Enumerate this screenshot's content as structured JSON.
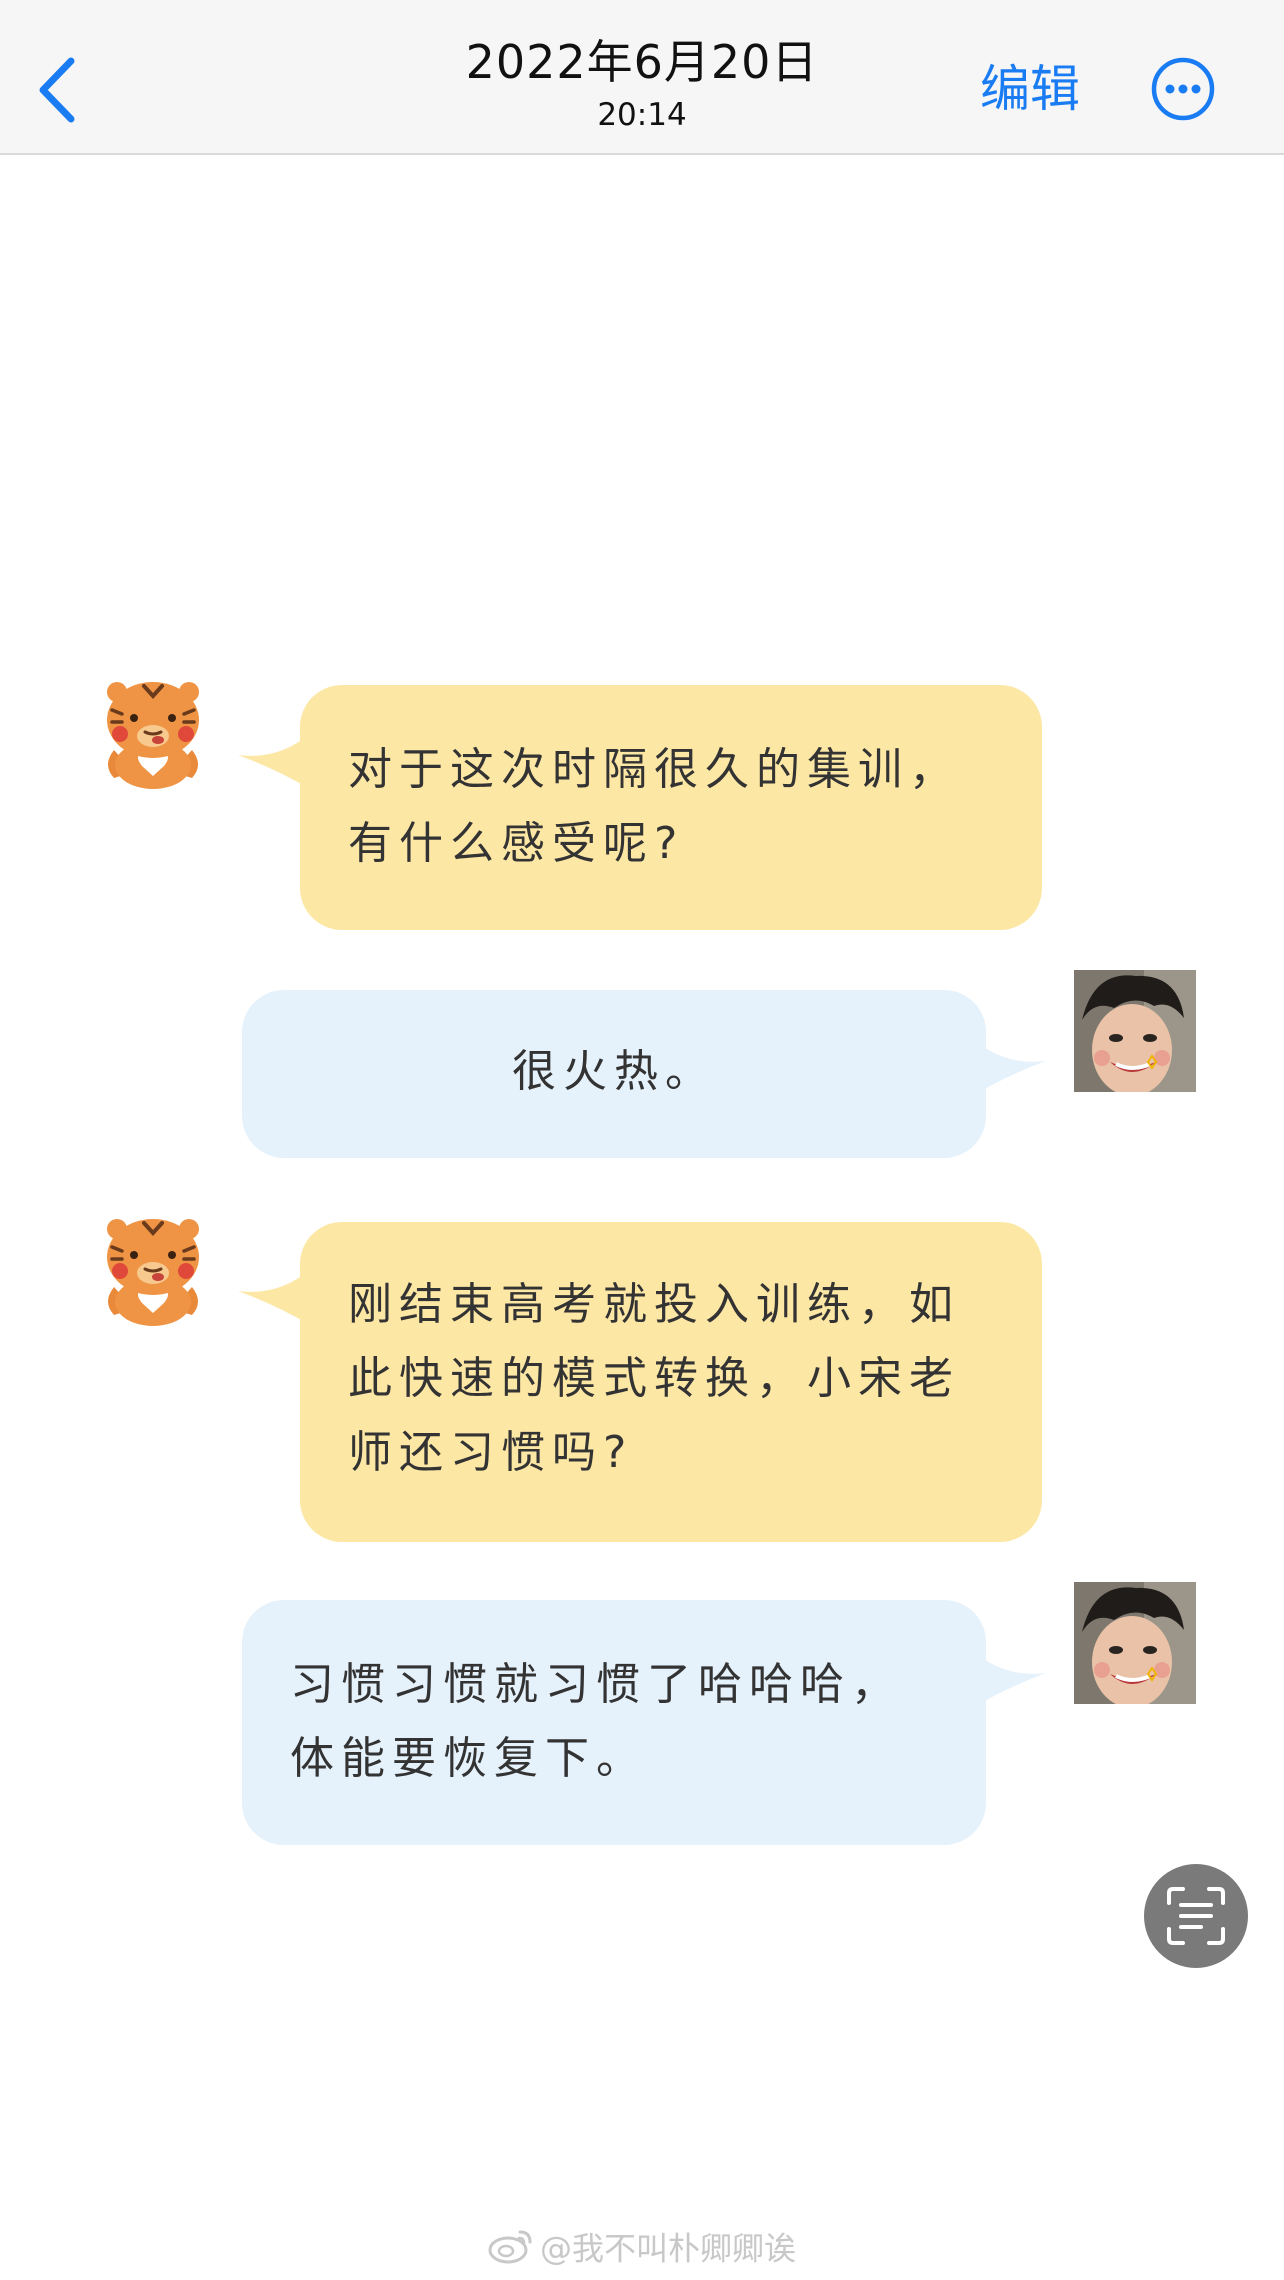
{
  "header": {
    "back_icon": "chevron-left-icon",
    "date": "2022年6月20日",
    "time": "20:14",
    "edit_label": "编辑",
    "more_icon": "ellipsis-circle-icon",
    "accent_color": "#1a7cf2"
  },
  "messages": [
    {
      "side": "left",
      "avatar": "tiger-sticker-avatar",
      "bubble_color": "#fde7a5",
      "lines": [
        "对于这次时隔很久的集训，",
        "有什么感受呢?"
      ]
    },
    {
      "side": "right",
      "avatar": "person-photo-avatar",
      "bubble_color": "#e6f2fb",
      "lines": [
        "很火热。"
      ]
    },
    {
      "side": "left",
      "avatar": "tiger-sticker-avatar",
      "bubble_color": "#fde7a5",
      "lines": [
        "刚结束高考就投入训练，如",
        "此快速的模式转换，小宋老",
        "师还习惯吗?"
      ]
    },
    {
      "side": "right",
      "avatar": "person-photo-avatar",
      "bubble_color": "#e6f2fb",
      "lines": [
        "习惯习惯就习惯了哈哈哈，",
        "体能要恢复下。"
      ]
    }
  ],
  "scan_button_icon": "text-scan-icon",
  "watermark": {
    "icon": "weibo-logo-icon",
    "text": "@我不叫朴卿卿诶"
  }
}
